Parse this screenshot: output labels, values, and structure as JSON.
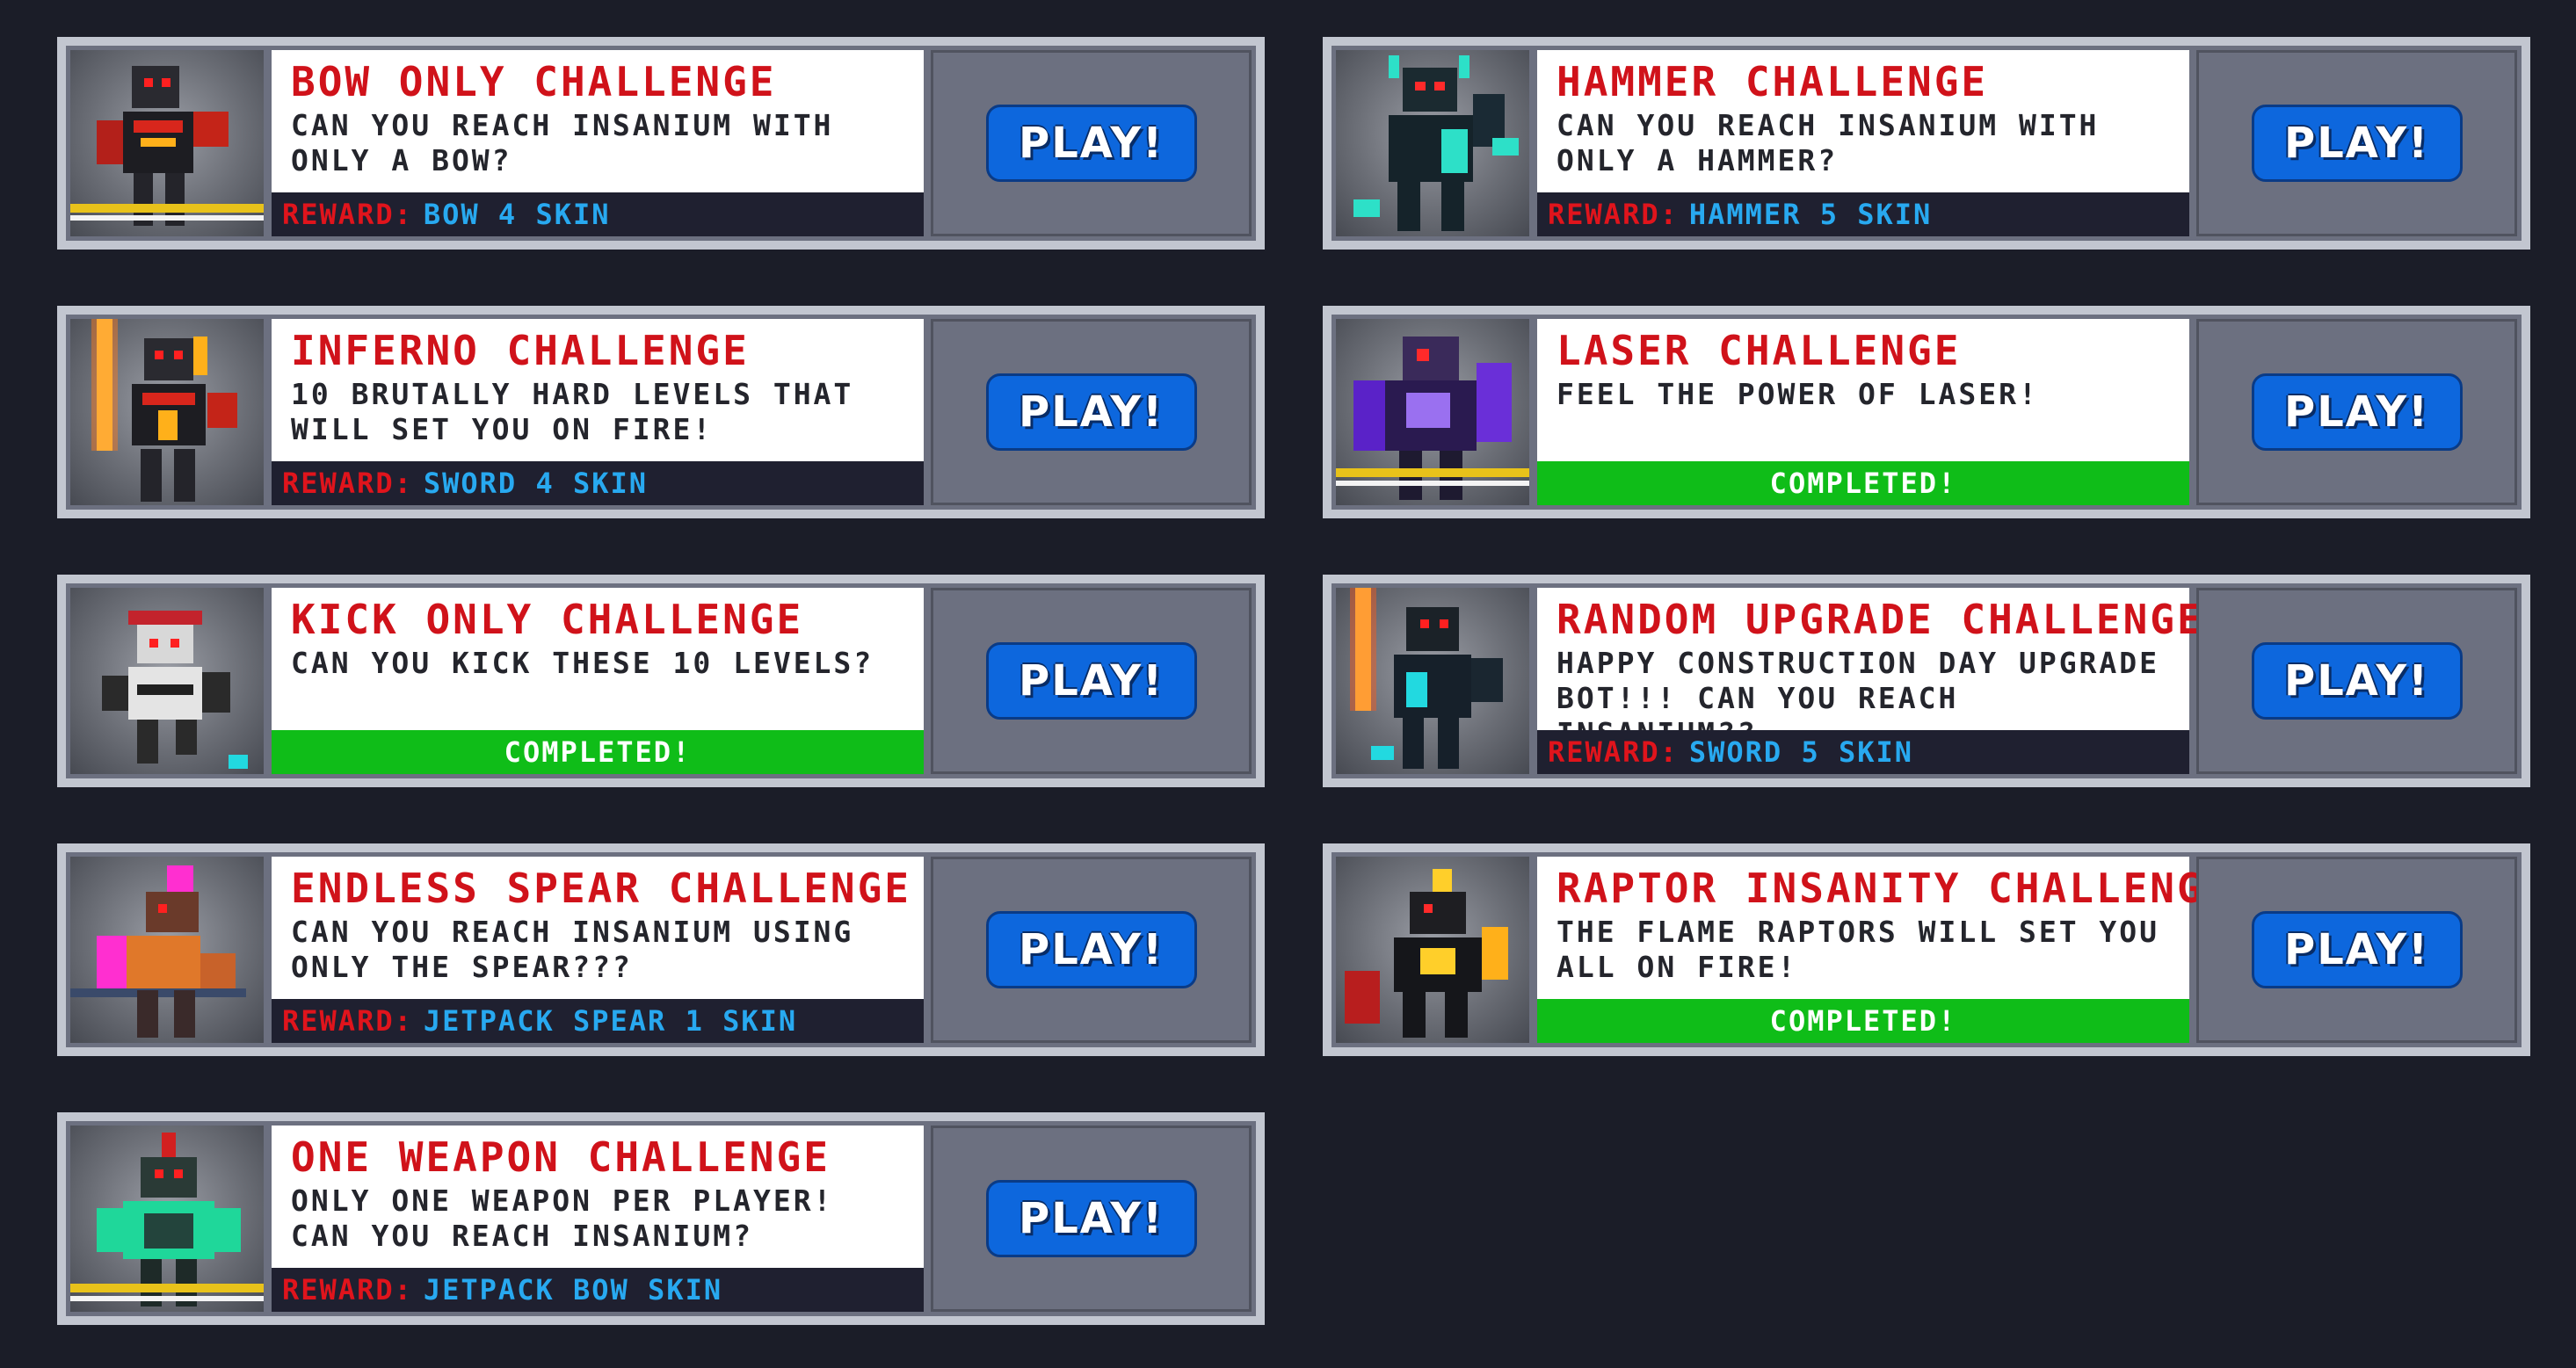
{
  "challenges": [
    {
      "title": "BOW ONLY CHALLENGE",
      "description": "CAN YOU REACH INSANIUM WITH ONLY A BOW?",
      "reward_label": "REWARD:",
      "reward": "BOW 4 SKIN",
      "status": "",
      "play_label": "PLAY!",
      "portrait": "bow-robot-icon",
      "accent": "#d33a1c"
    },
    {
      "title": "HAMMER CHALLENGE",
      "description": "CAN YOU REACH INSANIUM WITH ONLY A HAMMER?",
      "reward_label": "REWARD:",
      "reward": "HAMMER 5 SKIN",
      "status": "",
      "play_label": "PLAY!",
      "portrait": "hammer-robot-icon",
      "accent": "#2de0c8"
    },
    {
      "title": "INFERNO CHALLENGE",
      "description": "10 BRUTALLY HARD LEVELS THAT WILL SET YOU ON FIRE!",
      "reward_label": "REWARD:",
      "reward": "SWORD 4 SKIN",
      "status": "",
      "play_label": "PLAY!",
      "portrait": "inferno-robot-icon",
      "accent": "#ff7a1a"
    },
    {
      "title": "LASER CHALLENGE",
      "description": "FEEL THE POWER OF LASER!",
      "reward_label": "",
      "reward": "",
      "status": "COMPLETED!",
      "play_label": "PLAY!",
      "portrait": "laser-robot-icon",
      "accent": "#6a2fd8"
    },
    {
      "title": "KICK ONLY CHALLENGE",
      "description": "CAN YOU KICK THESE 10 LEVELS?",
      "reward_label": "",
      "reward": "",
      "status": "COMPLETED!",
      "play_label": "PLAY!",
      "portrait": "kick-robot-icon",
      "accent": "#c3232c"
    },
    {
      "title": "RANDOM UPGRADE CHALLENGE",
      "description": "HAPPY CONSTRUCTION DAY UPGRADE BOT!!! CAN YOU REACH INSANIUM??",
      "reward_label": "REWARD:",
      "reward": "SWORD 5 SKIN",
      "status": "",
      "play_label": "PLAY!",
      "portrait": "upgrade-robot-icon",
      "accent": "#22d9e0"
    },
    {
      "title": "ENDLESS SPEAR CHALLENGE",
      "description": "CAN YOU REACH INSANIUM USING ONLY THE SPEAR???",
      "reward_label": "REWARD:",
      "reward": "JETPACK SPEAR 1 SKIN",
      "status": "",
      "play_label": "PLAY!",
      "portrait": "spear-robot-icon",
      "accent": "#ff2fd0"
    },
    {
      "title": "RAPTOR INSANITY CHALLENGE",
      "description": "THE FLAME RAPTORS WILL SET YOU ALL ON FIRE!",
      "reward_label": "",
      "reward": "",
      "status": "COMPLETED!",
      "play_label": "PLAY!",
      "portrait": "raptor-robot-icon",
      "accent": "#ffcf2a"
    },
    {
      "title": "ONE WEAPON CHALLENGE",
      "description": "ONLY ONE WEAPON PER PLAYER! CAN YOU REACH INSANIUM?",
      "reward_label": "REWARD:",
      "reward": "JETPACK BOW SKIN",
      "status": "",
      "play_label": "PLAY!",
      "portrait": "one-weapon-robot-icon",
      "accent": "#1fd79a"
    }
  ]
}
